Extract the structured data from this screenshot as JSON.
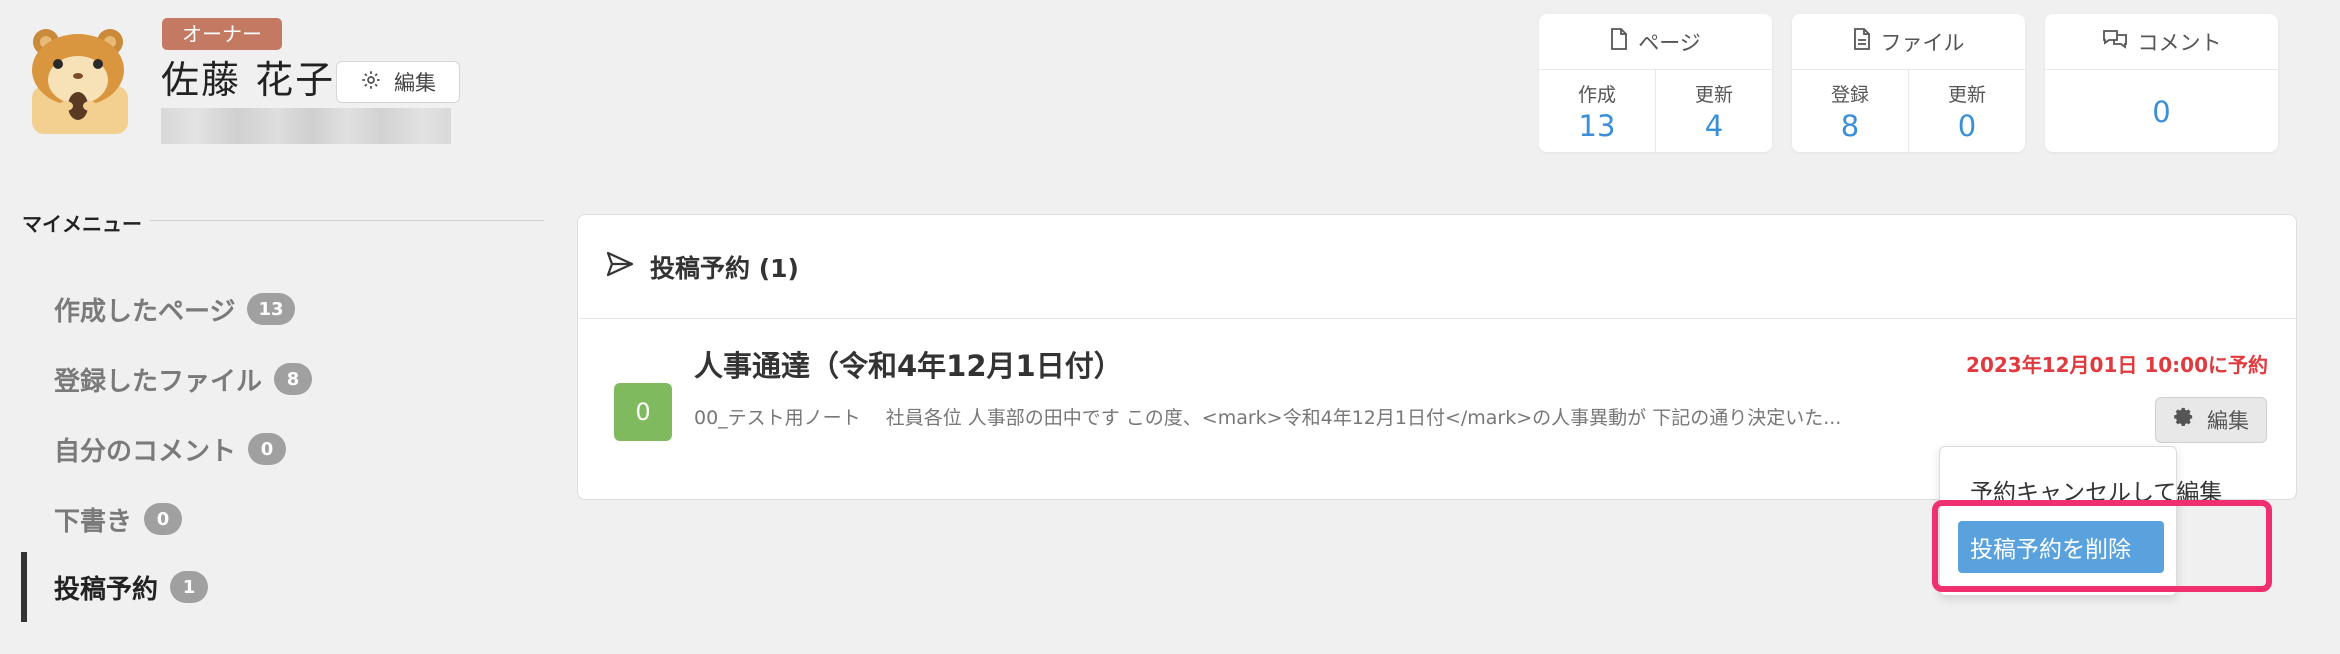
{
  "profile": {
    "role_badge": "オーナー",
    "name": "佐藤 花子",
    "edit_label": "編集"
  },
  "stats": {
    "pages": {
      "title": "ページ",
      "created_label": "作成",
      "created_value": "13",
      "updated_label": "更新",
      "updated_value": "4"
    },
    "files": {
      "title": "ファイル",
      "registered_label": "登録",
      "registered_value": "8",
      "updated_label": "更新",
      "updated_value": "0"
    },
    "comments": {
      "title": "コメント",
      "value": "0"
    }
  },
  "sidebar": {
    "title": "マイメニュー",
    "items": [
      {
        "label": "作成したページ",
        "count": "13"
      },
      {
        "label": "登録したファイル",
        "count": "8"
      },
      {
        "label": "自分のコメント",
        "count": "0"
      },
      {
        "label": "下書き",
        "count": "0"
      },
      {
        "label": "投稿予約",
        "count": "1"
      }
    ]
  },
  "panel": {
    "title": "投稿予約 (1)",
    "post": {
      "thumb_text": "0",
      "title": "人事通達（令和4年12月1日付）",
      "excerpt": "00_テスト用ノート　 社員各位 人事部の田中です この度、<mark>令和4年12月1日付</mark>の人事異動が 下記の通り決定いた...",
      "schedule": "2023年12月01日 10:00に予約",
      "edit_label": "編集"
    }
  },
  "dropdown": {
    "cancel_label": "予約キャンセルして編集",
    "delete_label": "投稿予約を削除"
  },
  "colors": {
    "accent_blue": "#3b8fd8",
    "schedule_red": "#e0393e",
    "highlight_pink": "#f0306e",
    "role_badge": "#c47a62",
    "thumb_green": "#7fba5e"
  }
}
